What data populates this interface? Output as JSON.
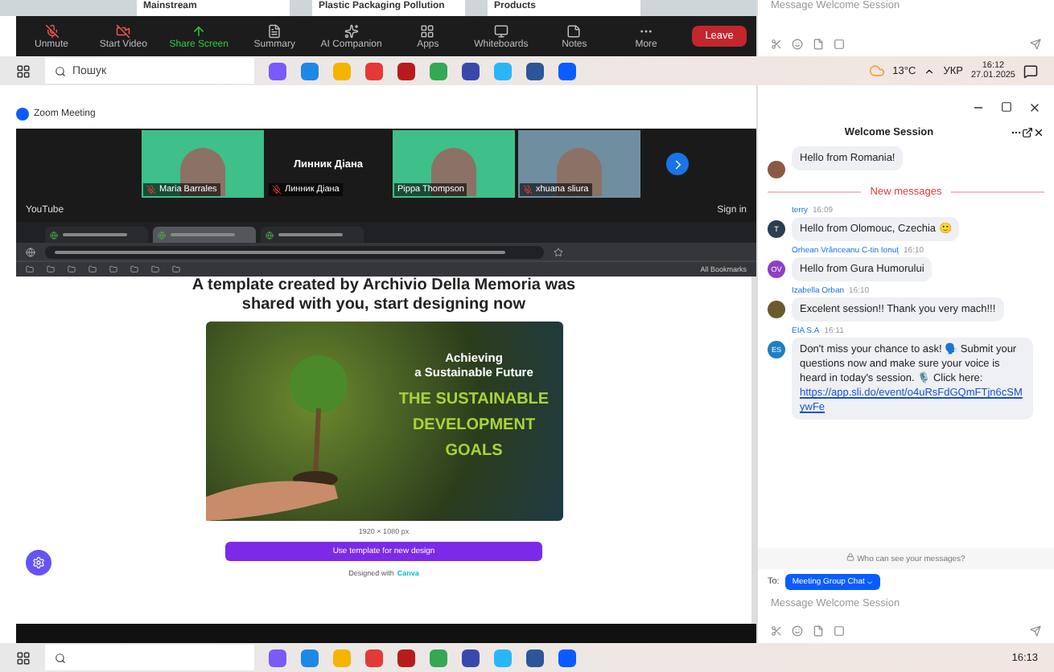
{
  "slide_strip": {
    "titles": [
      "Mainstream",
      "Plastic Packaging Pollution",
      "Products"
    ]
  },
  "meeting_toolbar": {
    "buttons": [
      {
        "label": "Unmute",
        "kind": "mic"
      },
      {
        "label": "Start Video",
        "kind": "video"
      },
      {
        "label": "Share Screen",
        "kind": "share"
      },
      {
        "label": "Summary",
        "kind": "summary"
      },
      {
        "label": "AI Companion",
        "kind": "ai"
      },
      {
        "label": "Apps",
        "kind": "apps"
      },
      {
        "label": "Whiteboards",
        "kind": "whiteboard"
      },
      {
        "label": "Notes",
        "kind": "notes"
      },
      {
        "label": "More",
        "kind": "more"
      }
    ],
    "leave": "Leave"
  },
  "chat_top": {
    "placeholder": "Message Welcome Session"
  },
  "taskbar": {
    "search": "Пошук",
    "weather": "13°C",
    "language": "УКР",
    "time": "16:12",
    "date": "27.01.2025"
  },
  "zoom_window": {
    "title": "Zoom Meeting"
  },
  "video_tiles": [
    {
      "name": "Maria Barrales",
      "kind": "video",
      "muted": true
    },
    {
      "name": "Линник Діана",
      "center_name": "Линник Діана",
      "kind": "name",
      "muted": true
    },
    {
      "name": "Pippa Thompson",
      "kind": "video",
      "muted": false
    },
    {
      "name": "xhuana sliura",
      "kind": "photo",
      "muted": true
    }
  ],
  "youtube": {
    "title": "YouTube",
    "sign_in": "Sign in"
  },
  "browser": {
    "tabs": [
      {
        "selected": false
      },
      {
        "selected": true
      },
      {
        "selected": false
      }
    ],
    "bookmark_all": "All Bookmarks"
  },
  "canva": {
    "heading": "A template created by Archivio Della Memoria was shared with you, start designing now",
    "banner_kicker": "Achieving",
    "banner_subtitle": "a Sustainable Future",
    "banner_title": "THE SUSTAINABLE DEVELOPMENT GOALS",
    "size": "1920 × 1080 px",
    "button": "Use template for new design",
    "credit": "Designed with",
    "brand": "Canva"
  },
  "chat": {
    "title": "Welcome Session",
    "items": [
      {
        "kind": "message",
        "text": "Hello from Romania!",
        "avatar": {
          "kind": "photo",
          "color": "#8a5a44"
        }
      },
      {
        "kind": "divider",
        "text": "New messages"
      },
      {
        "kind": "message",
        "sender": "terry",
        "time": "16:09",
        "text": "Hello from Olomouc, Czechia 🙂",
        "avatar": {
          "kind": "initials",
          "initials": "T",
          "color": "#2c3e50"
        }
      },
      {
        "kind": "message",
        "sender": "Orhean Vrânceanu C-tin Ionuț",
        "time": "16:10",
        "text": "Hello from Gura Humorului",
        "avatar": {
          "kind": "initials",
          "initials": "OV",
          "color": "#8e3fc4"
        }
      },
      {
        "kind": "message",
        "sender": "Izabella Orban",
        "time": "16:10",
        "text": "Excelent session!! Thank you very mach!!!",
        "avatar": {
          "kind": "photo",
          "color": "#6b5a2e"
        }
      },
      {
        "kind": "message",
        "sender": "EIA S.A",
        "time": "16:11",
        "text": "Don't miss your chance to ask! 🗣️ Submit your questions now and make sure your voice is heard in today's session. 🎙️ Click here:",
        "link": "https://app.sli.do/event/o4uRsFdGQmFTjn6cSMywFe",
        "avatar": {
          "kind": "initials",
          "initials": "ES",
          "color": "#1f7fc4"
        }
      }
    ],
    "privacy": "Who can see your messages?",
    "to_label": "To:",
    "recipient": "Meeting Group Chat",
    "placeholder": "Message Welcome Session"
  },
  "taskbar_bottom": {
    "time": "16:13"
  }
}
